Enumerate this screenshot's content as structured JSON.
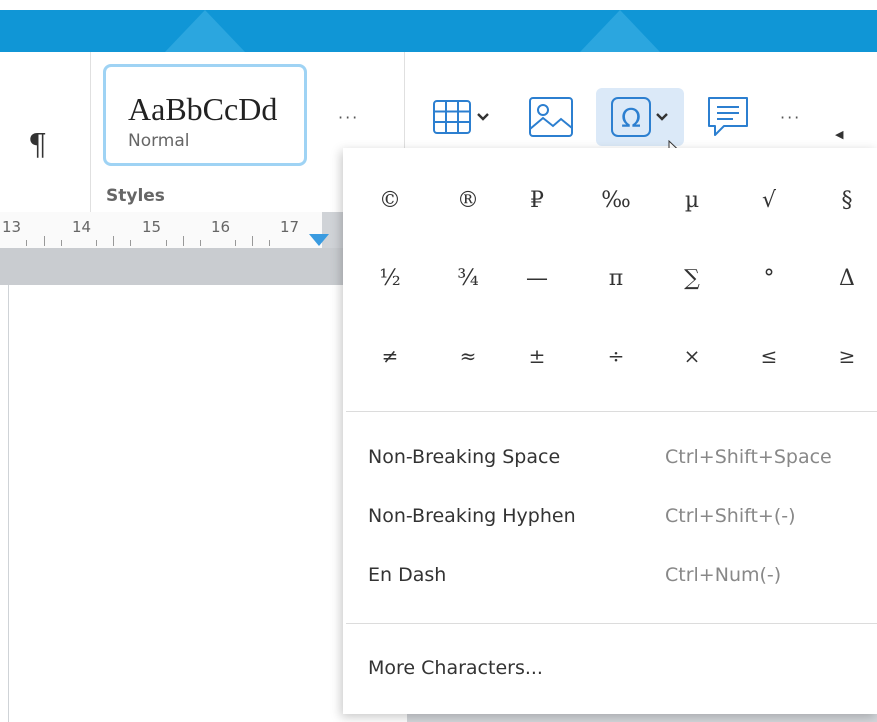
{
  "ribbon": {
    "paragraph_mark": "¶",
    "style_sample": "AaBbCcDd",
    "style_name": "Normal",
    "styles_more": "···",
    "styles_group_label": "Styles",
    "insert_more": "···",
    "icons": [
      "table-icon",
      "image-icon",
      "special-character-icon",
      "comment-icon",
      "scroll-left-icon"
    ]
  },
  "ruler": {
    "numbers": [
      "13",
      "14",
      "15",
      "16",
      "17"
    ]
  },
  "symbols": {
    "rows": [
      [
        "©",
        "®",
        "₽",
        "‰",
        "µ",
        "√",
        "§"
      ],
      [
        "½",
        "¾",
        "—",
        "π",
        "∑",
        "°",
        "Δ"
      ],
      [
        "≠",
        "≈",
        "±",
        "÷",
        "×",
        "≤",
        "≥"
      ]
    ]
  },
  "menu": {
    "items": [
      {
        "label": "Non-Breaking Space",
        "shortcut": "Ctrl+Shift+Space"
      },
      {
        "label": "Non-Breaking Hyphen",
        "shortcut": "Ctrl+Shift+(-)"
      },
      {
        "label": "En Dash",
        "shortcut": "Ctrl+Num(-)"
      }
    ],
    "more": "More Characters..."
  },
  "colors": {
    "accent": "#1096d6",
    "active_button": "#dbe9f8",
    "style_card_border": "#9fd3f4"
  }
}
